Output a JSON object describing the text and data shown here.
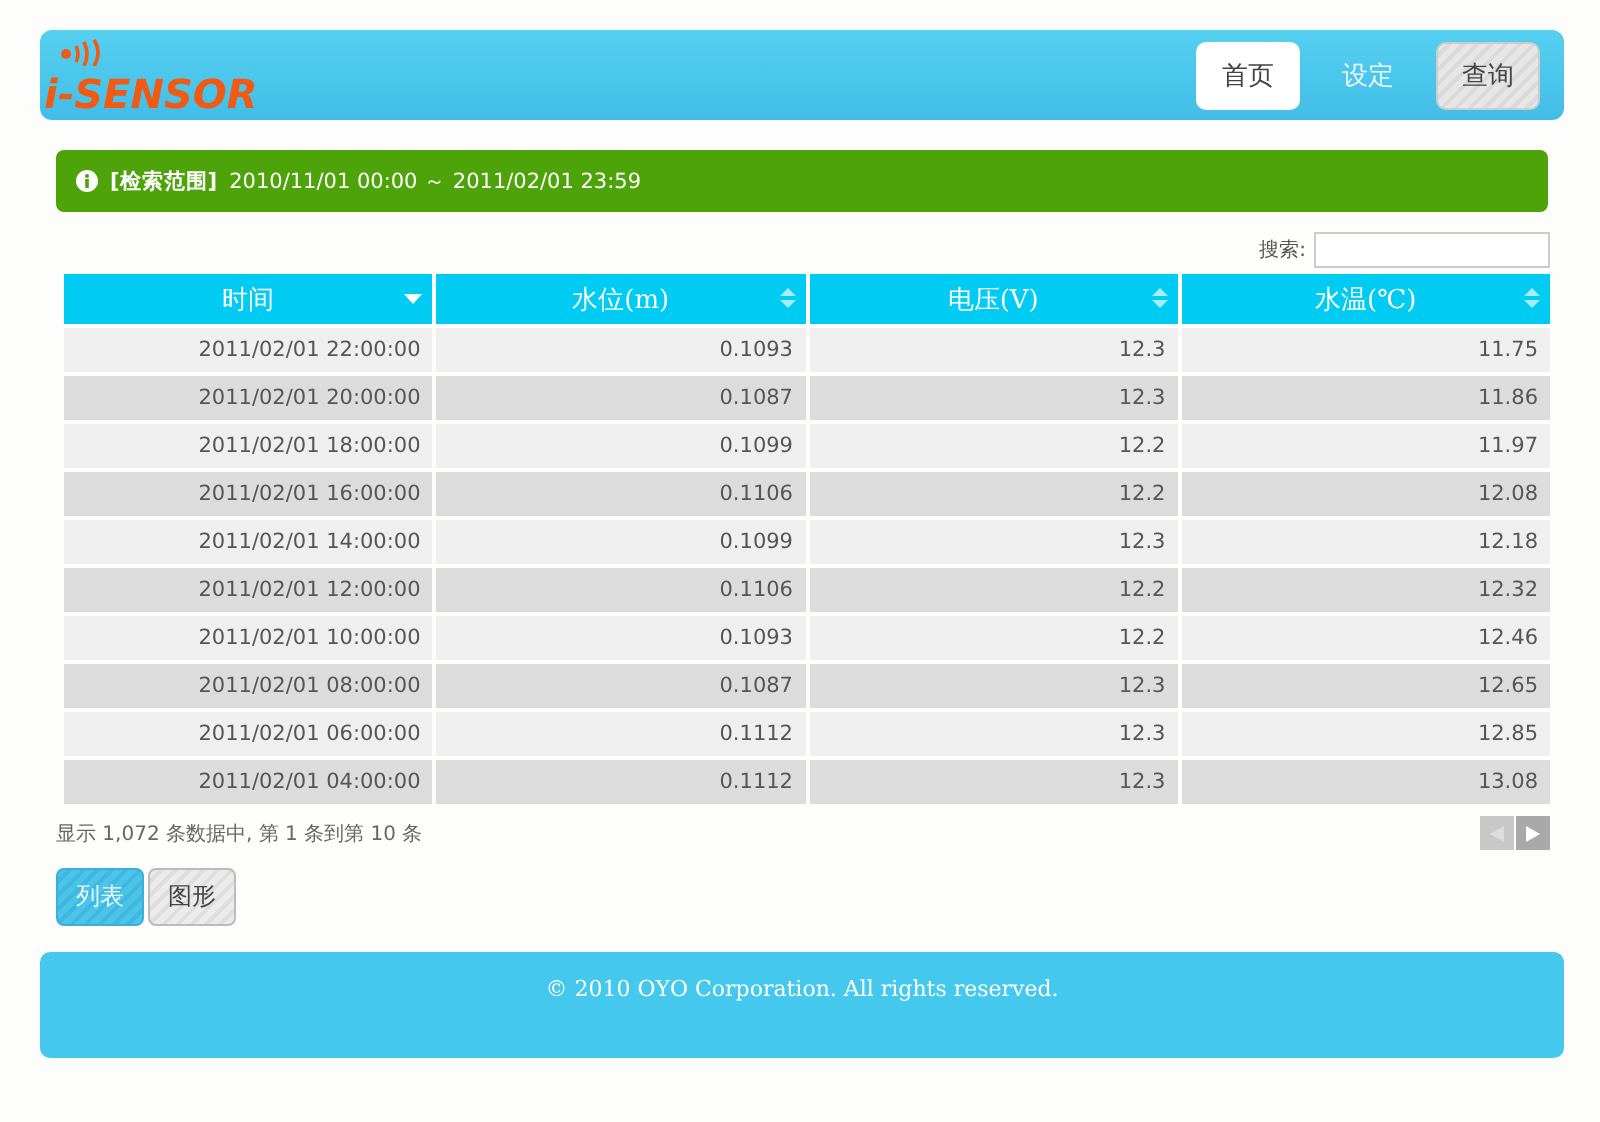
{
  "header": {
    "logo": "i-SENSOR",
    "nav": [
      {
        "label": "首页",
        "kind": "link",
        "selected": true
      },
      {
        "label": "设定",
        "kind": "link",
        "selected": false
      },
      {
        "label": "查询",
        "kind": "button",
        "selected": false
      }
    ]
  },
  "range_banner": {
    "label": "[检索范围]",
    "value": "2010/11/01 00:00 ～ 2011/02/01 23:59"
  },
  "search": {
    "label": "搜索:"
  },
  "table": {
    "columns": [
      {
        "label": "时间",
        "sorted": true
      },
      {
        "label": "水位(m)",
        "sorted": false
      },
      {
        "label": "电压(V)",
        "sorted": false
      },
      {
        "label": "水温(℃)",
        "sorted": false
      }
    ],
    "rows": [
      [
        "2011/02/01 22:00:00",
        "0.1093",
        "12.3",
        "11.75"
      ],
      [
        "2011/02/01 20:00:00",
        "0.1087",
        "12.3",
        "11.86"
      ],
      [
        "2011/02/01 18:00:00",
        "0.1099",
        "12.2",
        "11.97"
      ],
      [
        "2011/02/01 16:00:00",
        "0.1106",
        "12.2",
        "12.08"
      ],
      [
        "2011/02/01 14:00:00",
        "0.1099",
        "12.3",
        "12.18"
      ],
      [
        "2011/02/01 12:00:00",
        "0.1106",
        "12.2",
        "12.32"
      ],
      [
        "2011/02/01 10:00:00",
        "0.1093",
        "12.2",
        "12.46"
      ],
      [
        "2011/02/01 08:00:00",
        "0.1087",
        "12.3",
        "12.65"
      ],
      [
        "2011/02/01 06:00:00",
        "0.1112",
        "12.3",
        "12.85"
      ],
      [
        "2011/02/01 04:00:00",
        "0.1112",
        "12.3",
        "13.08"
      ]
    ]
  },
  "info": "显示 1,072 条数据中, 第 1 条到第 10 条",
  "pager": {
    "previous_disabled": true,
    "next_disabled": false
  },
  "view_buttons": [
    {
      "label": "列表",
      "selected": true
    },
    {
      "label": "图形",
      "selected": false
    }
  ],
  "footer": "© 2010 OYO Corporation. All rights reserved."
}
